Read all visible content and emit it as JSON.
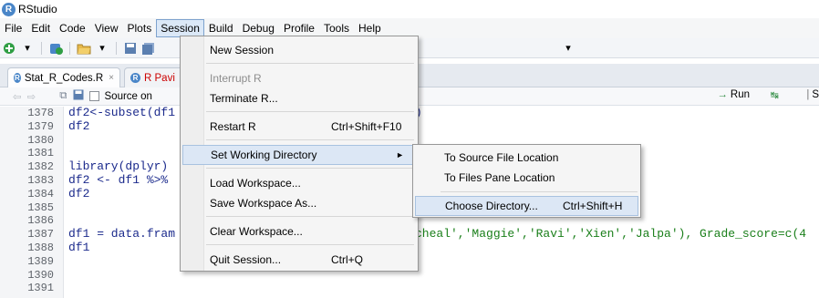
{
  "window": {
    "title": "RStudio",
    "logo_letter": "R"
  },
  "menubar": [
    "File",
    "Edit",
    "Code",
    "View",
    "Plots",
    "Session",
    "Build",
    "Debug",
    "Profile",
    "Tools",
    "Help"
  ],
  "tabs": [
    {
      "label": "Stat_R_Codes.R",
      "close": "×"
    },
    {
      "label": "R Pavi"
    }
  ],
  "editor_toolbar": {
    "source_on_save": "Source on",
    "run": "Run",
    "source": "S"
  },
  "editor": {
    "line_numbers": [
      "1378",
      "1379",
      "1380",
      "1381",
      "1382",
      "1383",
      "1384",
      "1385",
      "1386",
      "1387",
      "1388",
      "1389",
      "1390",
      "1391"
    ],
    "lines": [
      {
        "text": "df2<-subset(df1",
        "tail": ")"
      },
      {
        "text": "df2",
        "tail": ""
      },
      {
        "text": "",
        "tail": ""
      },
      {
        "text": "",
        "tail": ""
      },
      {
        "text": "library(dplyr)",
        "tail": ""
      },
      {
        "text": "df2 <- df1 %>%",
        "tail": ""
      },
      {
        "text": "df2",
        "tail": ""
      },
      {
        "text": "",
        "tail": ""
      },
      {
        "text": "",
        "tail": ""
      },
      {
        "text": "df1 = data.fram",
        "tail": "cheal','Maggie','Ravi','Xien','Jalpa'), Grade_score=c(4"
      },
      {
        "text": "df1",
        "tail": ""
      },
      {
        "text": "",
        "tail": ""
      },
      {
        "text": "",
        "tail": ""
      },
      {
        "text": "",
        "tail": ""
      }
    ]
  },
  "session_menu": {
    "items": [
      {
        "id": "new-session",
        "label": "New Session",
        "shortcut": "",
        "disabled": false
      },
      {
        "id": "interrupt-r",
        "label": "Interrupt R",
        "shortcut": "",
        "disabled": true
      },
      {
        "id": "terminate-r",
        "label": "Terminate R...",
        "shortcut": "",
        "disabled": false
      },
      {
        "id": "restart-r",
        "label": "Restart R",
        "shortcut": "Ctrl+Shift+F10",
        "disabled": false
      },
      {
        "id": "set-working-directory",
        "label": "Set Working Directory",
        "shortcut": "",
        "disabled": false,
        "submenu_arrow": "►"
      },
      {
        "id": "load-workspace",
        "label": "Load Workspace...",
        "shortcut": "",
        "disabled": false
      },
      {
        "id": "save-workspace-as",
        "label": "Save Workspace As...",
        "shortcut": "",
        "disabled": false
      },
      {
        "id": "clear-workspace",
        "label": "Clear Workspace...",
        "shortcut": "",
        "disabled": false
      },
      {
        "id": "quit-session",
        "label": "Quit Session...",
        "shortcut": "Ctrl+Q",
        "disabled": false
      }
    ]
  },
  "working_dir_submenu": {
    "items": [
      {
        "id": "to-source-file-location",
        "label": "To Source File Location",
        "shortcut": ""
      },
      {
        "id": "to-files-pane-location",
        "label": "To Files Pane Location",
        "shortcut": ""
      },
      {
        "id": "choose-directory",
        "label": "Choose Directory...",
        "shortcut": "Ctrl+Shift+H"
      }
    ]
  },
  "colors": {
    "menu_highlight": "#dce7f5",
    "code_text": "#1b2a8c",
    "string": "#1a7f1a"
  }
}
